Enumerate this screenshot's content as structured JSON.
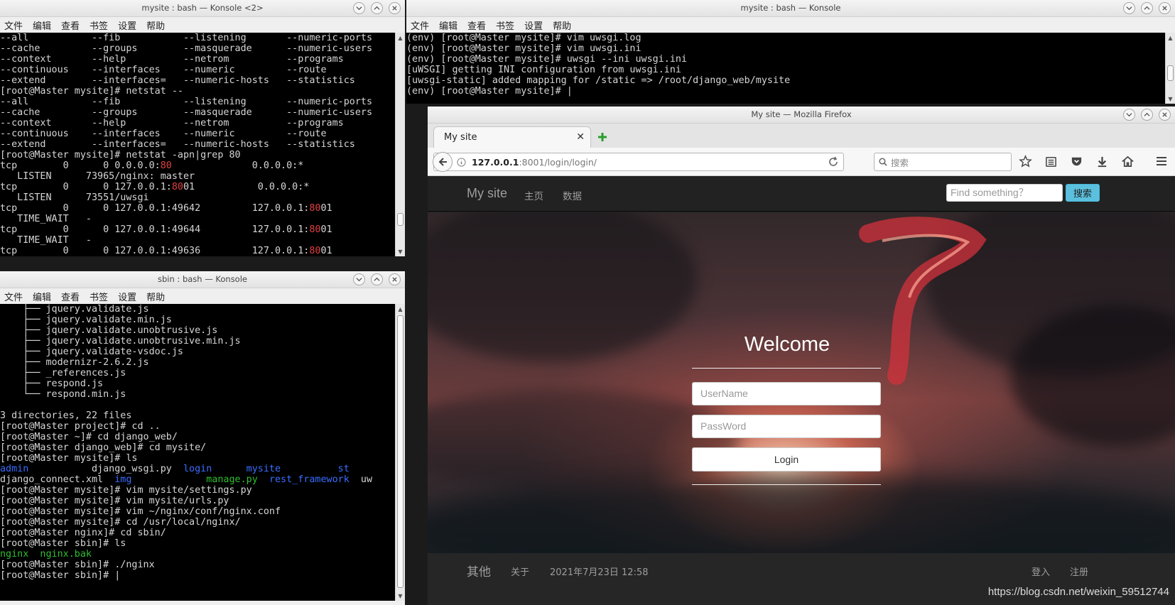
{
  "windows": {
    "top_left_title": "mysite : bash — Konsole <2>",
    "top_right_title": "mysite : bash — Konsole",
    "bottom_left_title": "sbin : bash — Konsole",
    "firefox_title": "My site — Mozilla Firefox"
  },
  "konsole_menu": [
    "文件",
    "编辑",
    "查看",
    "书签",
    "设置",
    "帮助"
  ],
  "term_top_left": [
    [
      {
        "t": "--all           --fib           --listening       --numeric-ports"
      }
    ],
    [
      {
        "t": "--cache         --groups        --masquerade      --numeric-users"
      }
    ],
    [
      {
        "t": "--context       --help          --netrom          --programs"
      }
    ],
    [
      {
        "t": "--continuous    --interfaces    --numeric         --route"
      }
    ],
    [
      {
        "t": "--extend        --interfaces=   --numeric-hosts   --statistics"
      }
    ],
    [
      {
        "t": "[root@Master mysite]# netstat --"
      }
    ],
    [
      {
        "t": "--all           --fib           --listening       --numeric-ports"
      }
    ],
    [
      {
        "t": "--cache         --groups        --masquerade      --numeric-users"
      }
    ],
    [
      {
        "t": "--context       --help          --netrom          --programs"
      }
    ],
    [
      {
        "t": "--continuous    --interfaces    --numeric         --route"
      }
    ],
    [
      {
        "t": "--extend        --interfaces=   --numeric-hosts   --statistics"
      }
    ],
    [
      {
        "t": "[root@Master mysite]# netstat -apn|grep 80"
      }
    ],
    [
      {
        "t": "tcp        0      0 0.0.0.0:"
      },
      {
        "t": "80",
        "c": "red"
      },
      {
        "t": "              0.0.0.0:*"
      }
    ],
    [
      {
        "t": "   LISTEN      73965/nginx: master"
      }
    ],
    [
      {
        "t": "tcp        0      0 127.0.0.1:"
      },
      {
        "t": "80",
        "c": "red"
      },
      {
        "t": "01           0.0.0.0:*"
      }
    ],
    [
      {
        "t": "   LISTEN      73551/uwsgi"
      }
    ],
    [
      {
        "t": "tcp        0      0 127.0.0.1:49642         127.0.0.1:"
      },
      {
        "t": "80",
        "c": "red"
      },
      {
        "t": "01"
      }
    ],
    [
      {
        "t": "   TIME_WAIT   -"
      }
    ],
    [
      {
        "t": "tcp        0      0 127.0.0.1:49644         127.0.0.1:"
      },
      {
        "t": "80",
        "c": "red"
      },
      {
        "t": "01"
      }
    ],
    [
      {
        "t": "   TIME_WAIT   -"
      }
    ],
    [
      {
        "t": "tcp        0      0 127.0.0.1:49636         127.0.0.1:"
      },
      {
        "t": "80",
        "c": "red"
      },
      {
        "t": "01"
      }
    ],
    [
      {
        "t": "   TIME_WAIT   -"
      }
    ]
  ],
  "term_top_right": [
    [
      {
        "t": "(env) [root@Master mysite]# vim uwsgi.log"
      }
    ],
    [
      {
        "t": "(env) [root@Master mysite]# vim uwsgi.ini"
      }
    ],
    [
      {
        "t": "(env) [root@Master mysite]# uwsgi --ini uwsgi.ini"
      }
    ],
    [
      {
        "t": "[uWSGI] getting INI configuration from uwsgi.ini"
      }
    ],
    [
      {
        "t": "[uwsgi-static] added mapping for /static => /root/django_web/mysite"
      }
    ],
    [
      {
        "t": "(env) [root@Master mysite]# |"
      }
    ]
  ],
  "term_bottom_left": [
    [
      {
        "t": "    ├── jquery.validate.js"
      }
    ],
    [
      {
        "t": "    ├── jquery.validate.min.js"
      }
    ],
    [
      {
        "t": "    ├── jquery.validate.unobtrusive.js"
      }
    ],
    [
      {
        "t": "    ├── jquery.validate.unobtrusive.min.js"
      }
    ],
    [
      {
        "t": "    ├── jquery.validate-vsdoc.js"
      }
    ],
    [
      {
        "t": "    ├── modernizr-2.6.2.js"
      }
    ],
    [
      {
        "t": "    ├── _references.js"
      }
    ],
    [
      {
        "t": "    ├── respond.js"
      }
    ],
    [
      {
        "t": "    └── respond.min.js"
      }
    ],
    [
      {
        "t": ""
      }
    ],
    [
      {
        "t": "3 directories, 22 files"
      }
    ],
    [
      {
        "t": "[root@Master project]# cd .."
      }
    ],
    [
      {
        "t": "[root@Master ~]# cd django_web/"
      }
    ],
    [
      {
        "t": "[root@Master django_web]# cd mysite/"
      }
    ],
    [
      {
        "t": "[root@Master mysite]# ls"
      }
    ],
    [
      {
        "t": "admin",
        "c": "blue"
      },
      {
        "t": "           django_wsgi.py  "
      },
      {
        "t": "login",
        "c": "blue"
      },
      {
        "t": "      "
      },
      {
        "t": "mysite",
        "c": "blue"
      },
      {
        "t": "          "
      },
      {
        "t": "st",
        "c": "blue"
      }
    ],
    [
      {
        "t": "django_connect.xml  "
      },
      {
        "t": "img",
        "c": "blue"
      },
      {
        "t": "             "
      },
      {
        "t": "manage.py",
        "c": "green"
      },
      {
        "t": "  "
      },
      {
        "t": "rest_framework",
        "c": "blue"
      },
      {
        "t": "  uw"
      }
    ],
    [
      {
        "t": "[root@Master mysite]# vim mysite/settings.py"
      }
    ],
    [
      {
        "t": "[root@Master mysite]# vim mysite/urls.py"
      }
    ],
    [
      {
        "t": "[root@Master mysite]# vim ~/nginx/conf/nginx.conf"
      }
    ],
    [
      {
        "t": "[root@Master mysite]# cd /usr/local/nginx/"
      }
    ],
    [
      {
        "t": "[root@Master nginx]# cd sbin/"
      }
    ],
    [
      {
        "t": "[root@Master sbin]# ls"
      }
    ],
    [
      {
        "t": "nginx  nginx.bak",
        "c": "green"
      }
    ],
    [
      {
        "t": "[root@Master sbin]# ./nginx"
      }
    ],
    [
      {
        "t": "[root@Master sbin]# |"
      }
    ]
  ],
  "firefox": {
    "tab_label": "My site",
    "url_host": "127.0.0.1",
    "url_rest": ":8001/login/login/",
    "search_placeholder": "搜索"
  },
  "site": {
    "brand": "My site",
    "nav": [
      "主页",
      "数据"
    ],
    "search_placeholder": "Find something？",
    "search_button": "搜索",
    "welcome": "Welcome",
    "username_placeholder": "UserName",
    "password_placeholder": "PassWord",
    "login_button": "Login",
    "footer_brand": "其他",
    "footer_about": "关于",
    "footer_date": "2021年7月23日 12:58",
    "footer_login": "登入",
    "footer_register": "注册",
    "watermark": "https://blog.csdn.net/weixin_59512744"
  },
  "colors": {
    "term_red": "#e04040",
    "term_blue": "#3a6dff",
    "term_green": "#2fbf2f",
    "search_btn": "#5bc0de"
  }
}
